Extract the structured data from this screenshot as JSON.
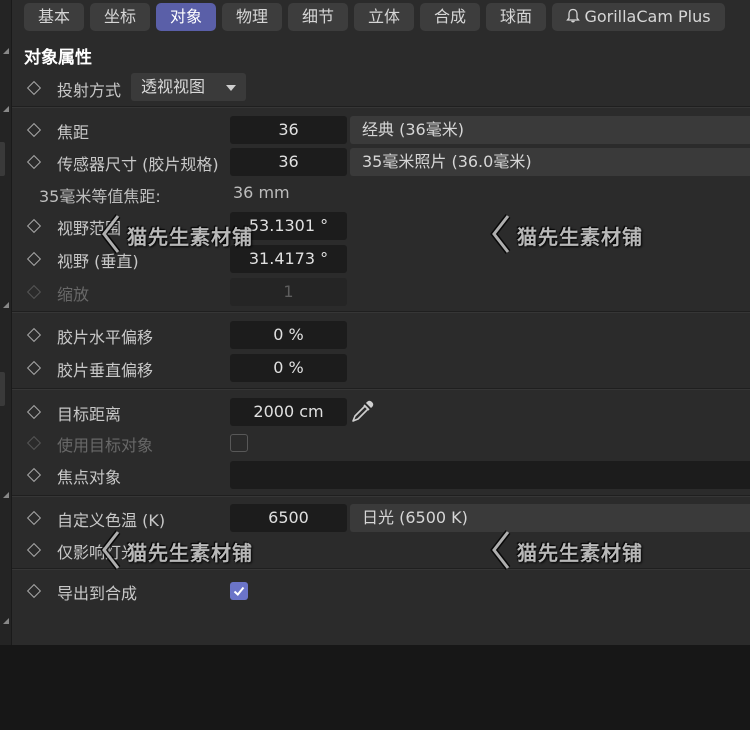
{
  "tabs": [
    {
      "label": "基本",
      "active": false
    },
    {
      "label": "坐标",
      "active": false
    },
    {
      "label": "对象",
      "active": true
    },
    {
      "label": "物理",
      "active": false
    },
    {
      "label": "细节",
      "active": false
    },
    {
      "label": "立体",
      "active": false
    },
    {
      "label": "合成",
      "active": false
    },
    {
      "label": "球面",
      "active": false
    },
    {
      "label": "GorillaCam Plus",
      "active": false,
      "icon": "bell-icon"
    }
  ],
  "section_title": "对象属性",
  "projection": {
    "label": "投射方式",
    "value": "透视视图"
  },
  "focal_length": {
    "label": "焦距",
    "value": "36",
    "preset": "经典 (36毫米)"
  },
  "sensor_size": {
    "label": "传感器尺寸 (胶片规格)",
    "value": "36",
    "preset": "35毫米照片 (36.0毫米)"
  },
  "equiv_focal": {
    "label": "35毫米等值焦距:",
    "value": "36 mm"
  },
  "fov_h": {
    "label": "视野范围",
    "value": "53.1301 °"
  },
  "fov_v": {
    "label": "视野 (垂直)",
    "value": "31.4173 °"
  },
  "zoom": {
    "label": "缩放",
    "value": "1",
    "disabled": true
  },
  "film_offset_x": {
    "label": "胶片水平偏移",
    "value": "0 %"
  },
  "film_offset_y": {
    "label": "胶片垂直偏移",
    "value": "0 %"
  },
  "target_distance": {
    "label": "目标距离",
    "value": "2000 cm"
  },
  "use_target": {
    "label": "使用目标对象",
    "checked": false,
    "disabled": true
  },
  "focus_object": {
    "label": "焦点对象",
    "value": ""
  },
  "color_temp": {
    "label": "自定义色温 (K)",
    "value": "6500",
    "preset": "日光 (6500 K)"
  },
  "affect_only": {
    "label": "仅影响灯光"
  },
  "export_composite": {
    "label": "导出到合成",
    "checked": true
  },
  "watermark_text": "猫先生素材铺",
  "colors": {
    "active_tab": "#5a5fa8",
    "panel_bg": "#2b2b2b",
    "field_bg": "#1c1c1c",
    "checkbox_on": "#6b74c8"
  }
}
